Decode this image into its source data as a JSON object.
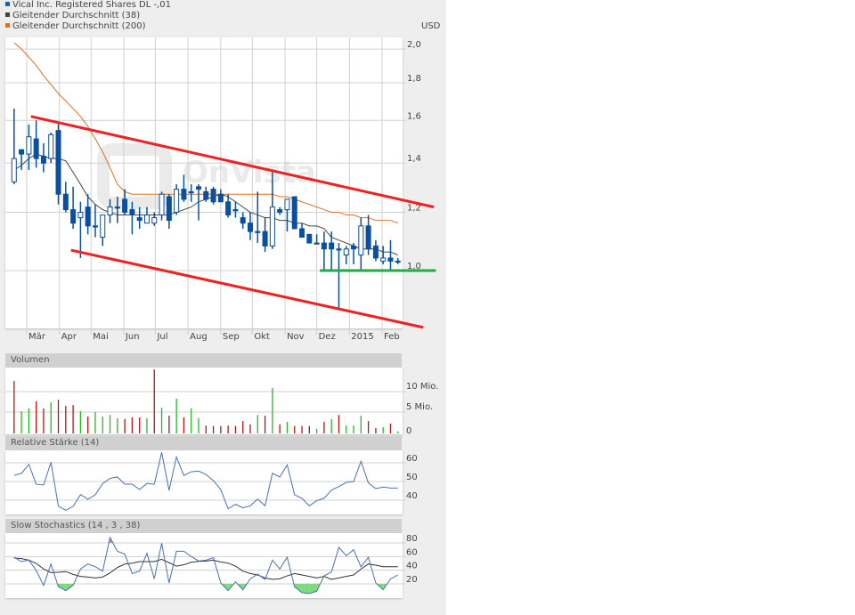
{
  "legend": [
    {
      "label": "Vical Inc. Registered Shares DL -,01",
      "color": "#1f5fa8"
    },
    {
      "label": "Gleitender Durchschnitt (38)",
      "color": "#444444"
    },
    {
      "label": "Gleitender Durchschnitt (200)",
      "color": "#e07020"
    }
  ],
  "currency": "USD",
  "watermark": "OnVista",
  "colors": {
    "candle": "#0a4fa0",
    "ma38": "#444444",
    "ma200": "#e07020",
    "trendline": "#ee2222",
    "support": "#22aa44",
    "vol_up": "#22bb22",
    "vol_down": "#bb1111",
    "rsi": "#4a6fb5",
    "stoch_k": "#4a6fb5",
    "stoch_d": "#333333",
    "stoch_low_fill": "#7ed87e",
    "stoch_high_fill": "#f08080"
  },
  "chart_data": [
    {
      "type": "candlestick",
      "yscale": "log",
      "ylim": [
        0.83,
        2.05
      ],
      "xlim": [
        "2014-02-09",
        "2015-02-20"
      ],
      "grid": true,
      "y_ticks": [
        "2,0",
        "1,8",
        "1,6",
        "1,4",
        "1,2",
        "1,0"
      ],
      "y_tick_values": [
        2.0,
        1.8,
        1.6,
        1.4,
        1.2,
        1.0
      ],
      "x_ticks": [
        "Mär",
        "Apr",
        "Mai",
        "Jun",
        "Jul",
        "Aug",
        "Sep",
        "Okt",
        "Nov",
        "Dez",
        "2015",
        "Feb"
      ],
      "x_tick_dates": [
        "2014-03-01",
        "2014-04-01",
        "2014-05-01",
        "2014-06-01",
        "2014-07-01",
        "2014-08-01",
        "2014-09-01",
        "2014-10-01",
        "2014-11-01",
        "2014-12-01",
        "2015-01-01",
        "2015-02-01"
      ],
      "dates": [
        "2014-02-17",
        "2014-02-24",
        "2014-03-03",
        "2014-03-10",
        "2014-03-17",
        "2014-03-24",
        "2014-03-31",
        "2014-04-07",
        "2014-04-14",
        "2014-04-21",
        "2014-04-28",
        "2014-05-05",
        "2014-05-12",
        "2014-05-19",
        "2014-05-26",
        "2014-06-02",
        "2014-06-09",
        "2014-06-16",
        "2014-06-23",
        "2014-06-30",
        "2014-07-07",
        "2014-07-14",
        "2014-07-21",
        "2014-07-28",
        "2014-08-04",
        "2014-08-11",
        "2014-08-18",
        "2014-08-25",
        "2014-09-01",
        "2014-09-08",
        "2014-09-15",
        "2014-09-22",
        "2014-09-29",
        "2014-10-06",
        "2014-10-13",
        "2014-10-20",
        "2014-10-27",
        "2014-11-03",
        "2014-11-10",
        "2014-11-17",
        "2014-11-24",
        "2014-12-01",
        "2014-12-08",
        "2014-12-15",
        "2014-12-22",
        "2014-12-29",
        "2015-01-05",
        "2015-01-12",
        "2015-01-19",
        "2015-01-26",
        "2015-02-02",
        "2015-02-09",
        "2015-02-16"
      ],
      "ohlc": [
        [
          1.32,
          1.66,
          1.31,
          1.42
        ],
        [
          1.46,
          1.46,
          1.37,
          1.44
        ],
        [
          1.44,
          1.58,
          1.37,
          1.52
        ],
        [
          1.51,
          1.6,
          1.38,
          1.42
        ],
        [
          1.43,
          1.49,
          1.36,
          1.4
        ],
        [
          1.42,
          1.54,
          1.4,
          1.53
        ],
        [
          1.55,
          1.59,
          1.23,
          1.27
        ],
        [
          1.27,
          1.32,
          1.2,
          1.21
        ],
        [
          1.21,
          1.3,
          1.14,
          1.16
        ],
        [
          1.18,
          1.24,
          1.04,
          1.2
        ],
        [
          1.22,
          1.27,
          1.12,
          1.15
        ],
        [
          1.15,
          1.23,
          1.11,
          1.15
        ],
        [
          1.11,
          1.19,
          1.08,
          1.19
        ],
        [
          1.19,
          1.25,
          1.16,
          1.22
        ],
        [
          1.22,
          1.26,
          1.16,
          1.22
        ],
        [
          1.25,
          1.29,
          1.19,
          1.2
        ],
        [
          1.21,
          1.24,
          1.12,
          1.19
        ],
        [
          1.18,
          1.22,
          1.14,
          1.17
        ],
        [
          1.16,
          1.22,
          1.16,
          1.19
        ],
        [
          1.16,
          1.2,
          1.15,
          1.18
        ],
        [
          1.19,
          1.28,
          1.17,
          1.27
        ],
        [
          1.26,
          1.27,
          1.14,
          1.17
        ],
        [
          1.2,
          1.31,
          1.19,
          1.29
        ],
        [
          1.29,
          1.35,
          1.24,
          1.25
        ],
        [
          1.28,
          1.31,
          1.24,
          1.28
        ],
        [
          1.3,
          1.31,
          1.17,
          1.29
        ],
        [
          1.28,
          1.3,
          1.24,
          1.25
        ],
        [
          1.29,
          1.3,
          1.23,
          1.24
        ],
        [
          1.27,
          1.29,
          1.24,
          1.24
        ],
        [
          1.24,
          1.27,
          1.18,
          1.19
        ],
        [
          1.21,
          1.24,
          1.18,
          1.21
        ],
        [
          1.18,
          1.2,
          1.14,
          1.16
        ],
        [
          1.16,
          1.2,
          1.1,
          1.13
        ],
        [
          1.13,
          1.28,
          1.09,
          1.13
        ],
        [
          1.13,
          1.18,
          1.06,
          1.08
        ],
        [
          1.08,
          1.36,
          1.07,
          1.22
        ],
        [
          1.21,
          1.22,
          1.19,
          1.2
        ],
        [
          1.21,
          1.25,
          1.13,
          1.25
        ],
        [
          1.26,
          1.26,
          1.14,
          1.14
        ],
        [
          1.14,
          1.16,
          1.11,
          1.11
        ],
        [
          1.12,
          1.12,
          1.09,
          1.09
        ],
        [
          1.09,
          1.12,
          1.09,
          1.09
        ],
        [
          1.09,
          1.13,
          1.0,
          1.07
        ],
        [
          1.09,
          1.13,
          1.0,
          1.07
        ],
        [
          1.07,
          1.09,
          0.89,
          1.07
        ],
        [
          1.05,
          1.08,
          1.02,
          1.07
        ],
        [
          1.08,
          1.09,
          1.02,
          1.07
        ],
        [
          1.05,
          1.18,
          1.0,
          1.15
        ],
        [
          1.15,
          1.19,
          1.05,
          1.07
        ],
        [
          1.08,
          1.1,
          1.03,
          1.04
        ],
        [
          1.03,
          1.08,
          1.02,
          1.04
        ],
        [
          1.04,
          1.1,
          1.0,
          1.03
        ],
        [
          1.03,
          1.04,
          1.02,
          1.03
        ]
      ],
      "series": [
        {
          "name": "Gleitender Durchschnitt (38)",
          "values": [
            1.37,
            1.39,
            1.42,
            1.44,
            1.43,
            1.42,
            1.42,
            1.41,
            1.36,
            1.31,
            1.26,
            1.23,
            1.21,
            1.2,
            1.19,
            1.19,
            1.19,
            1.19,
            1.19,
            1.19,
            1.19,
            1.19,
            1.2,
            1.21,
            1.22,
            1.24,
            1.25,
            1.26,
            1.27,
            1.26,
            1.24,
            1.22,
            1.2,
            1.19,
            1.18,
            1.18,
            1.17,
            1.17,
            1.16,
            1.16,
            1.15,
            1.15,
            1.14,
            1.11,
            1.1,
            1.09,
            1.08,
            1.07,
            1.07,
            1.07,
            1.06,
            1.06,
            1.05
          ]
        },
        {
          "name": "Gleitender Durchschnitt (200)",
          "values": [
            2.04,
            2.0,
            1.95,
            1.9,
            1.84,
            1.79,
            1.74,
            1.7,
            1.66,
            1.62,
            1.57,
            1.51,
            1.45,
            1.38,
            1.31,
            1.28,
            1.27,
            1.27,
            1.27,
            1.27,
            1.27,
            1.27,
            1.27,
            1.27,
            1.27,
            1.27,
            1.27,
            1.27,
            1.27,
            1.27,
            1.27,
            1.27,
            1.27,
            1.27,
            1.27,
            1.27,
            1.26,
            1.26,
            1.25,
            1.24,
            1.23,
            1.22,
            1.21,
            1.2,
            1.2,
            1.19,
            1.19,
            1.18,
            1.18,
            1.17,
            1.17,
            1.17,
            1.16
          ]
        }
      ],
      "annotations": [
        {
          "kind": "upper-trendline",
          "from": [
            "2014-03-05",
            1.62
          ],
          "to": [
            "2015-03-22",
            1.22
          ]
        },
        {
          "kind": "lower-trendline",
          "from": [
            "2014-04-12",
            1.066
          ],
          "to": [
            "2015-03-12",
            0.837
          ]
        },
        {
          "kind": "support-line",
          "from": [
            "2014-12-04",
            1.0
          ],
          "to": [
            "2015-03-24",
            1.0
          ]
        }
      ]
    },
    {
      "type": "bar",
      "title": "Volumen",
      "unit": "Mio.",
      "ylim": [
        0,
        16
      ],
      "y_ticks": [
        "10 Mio.",
        "5 Mio.",
        "0"
      ],
      "y_tick_values": [
        10,
        5,
        0
      ],
      "values": [
        12.6,
        5.2,
        5.9,
        7.6,
        5.9,
        7.4,
        8.0,
        6.5,
        6.7,
        5.2,
        3.9,
        5.0,
        3.9,
        4.3,
        3.5,
        3.3,
        3.7,
        3.7,
        3.5,
        15.4,
        6.1,
        4.1,
        8.3,
        3.7,
        5.9,
        3.5,
        1.7,
        1.6,
        1.6,
        1.7,
        1.6,
        2.8,
        2.0,
        4.3,
        4.1,
        10.9,
        2.0,
        2.6,
        1.6,
        1.6,
        1.6,
        0.9,
        2.6,
        3.3,
        4.3,
        1.7,
        1.7,
        4.1,
        2.8,
        1.1,
        1.3,
        2.2,
        0.3
      ],
      "up": [
        false,
        true,
        true,
        false,
        false,
        true,
        false,
        false,
        false,
        true,
        false,
        true,
        true,
        true,
        true,
        false,
        false,
        false,
        true,
        false,
        true,
        false,
        true,
        false,
        true,
        true,
        false,
        false,
        false,
        false,
        false,
        false,
        false,
        true,
        false,
        true,
        false,
        true,
        false,
        false,
        false,
        true,
        false,
        true,
        false,
        true,
        true,
        true,
        false,
        false,
        true,
        false,
        true
      ]
    },
    {
      "type": "line",
      "title": "Relative Stärke (14)",
      "ylim": [
        32,
        67
      ],
      "y_ticks": [
        "60",
        "50",
        "40"
      ],
      "y_tick_values": [
        60,
        50,
        40
      ],
      "values": [
        53.3,
        54.4,
        59.2,
        48.6,
        48.1,
        60.3,
        36.8,
        34.6,
        36.7,
        43.0,
        40.5,
        42.9,
        48.9,
        51.7,
        52.4,
        48.6,
        48.6,
        45.7,
        48.9,
        48.6,
        65.6,
        45.2,
        63.2,
        53.2,
        55.2,
        55.6,
        53.7,
        50.5,
        45.7,
        35.4,
        37.8,
        35.9,
        37.0,
        40.6,
        37.0,
        54.4,
        52.4,
        58.9,
        42.9,
        41.0,
        37.0,
        39.7,
        41.0,
        45.4,
        47.3,
        49.5,
        50.0,
        60.8,
        49.2,
        46.2,
        47.0,
        46.5,
        46.5
      ]
    },
    {
      "type": "line",
      "title": "Slow Stochastics (14 , 3 , 38)",
      "ylim": [
        0,
        92
      ],
      "y_ticks": [
        "80",
        "60",
        "40",
        "20"
      ],
      "y_tick_values": [
        80,
        60,
        40,
        20
      ],
      "series": [
        {
          "values": [
            59.1,
            52.6,
            54.8,
            39.6,
            17.8,
            49.1,
            15.7,
            10.0,
            17.8,
            41.7,
            49.1,
            45.2,
            38.7,
            88.0,
            67.8,
            63.5,
            35.2,
            38.7,
            64.8,
            27.4,
            79.6,
            21.3,
            67.8,
            67.8,
            60.0,
            53.5,
            54.8,
            58.3,
            21.3,
            10.0,
            23.0,
            11.3,
            27.4,
            34.3,
            26.5,
            54.8,
            41.7,
            59.1,
            15.7,
            7.0,
            5.7,
            9.1,
            31.7,
            37.4,
            73.5,
            61.3,
            70.0,
            44.8,
            59.1,
            21.3,
            11.3,
            27.4,
            33.0
          ]
        },
        {
          "values": [
            57.8,
            57.0,
            54.8,
            50.0,
            41.7,
            36.5,
            37.0,
            38.0,
            33.9,
            30.9,
            30.0,
            28.7,
            30.0,
            36.0,
            44.0,
            49.0,
            50.4,
            52.6,
            52.6,
            52.6,
            56.0,
            51.0,
            46.0,
            48.0,
            51.7,
            53.0,
            53.5,
            54.8,
            52.0,
            50.4,
            46.0,
            38.7,
            35.2,
            33.0,
            28.7,
            26.5,
            27.5,
            31.7,
            35.2,
            33.0,
            30.9,
            28.7,
            30.9,
            26.5,
            28.7,
            31.0,
            33.0,
            41.7,
            49.1,
            47.4,
            45.2,
            45.2,
            45.2
          ]
        }
      ],
      "bands": [
        20,
        80
      ]
    }
  ]
}
